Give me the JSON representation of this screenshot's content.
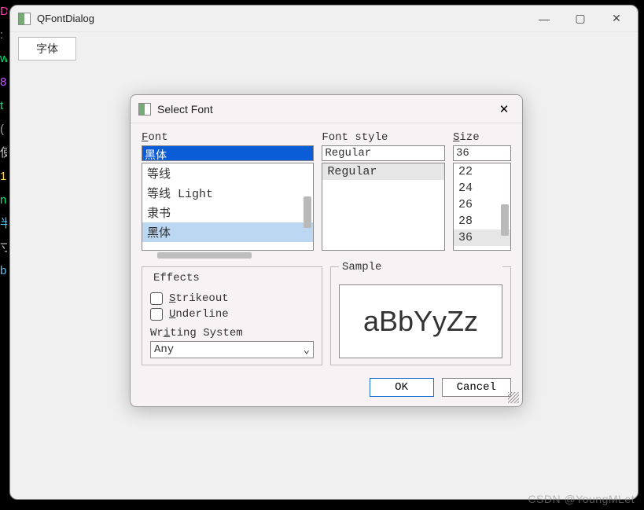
{
  "gutter": [
    "D",
    ":",
    "",
    "w",
    "",
    "8",
    "t",
    "",
    "",
    "(",
    "使",
    "1",
    "n",
    "",
    "半",
    "",
    "寸",
    "",
    "b",
    ""
  ],
  "gutter_colors": [
    "#ff3db3",
    "#9aa0a6",
    "",
    "#00e676",
    "",
    "#c253ff",
    "#00e676",
    "",
    "",
    "#9aa0a6",
    "#c9c9c9",
    "#ffd54a",
    "#00e676",
    "",
    "#4fc3f7",
    "",
    "#c9c9c9",
    "",
    "#4fc3f7",
    ""
  ],
  "main": {
    "title": "QFontDialog",
    "toolbar_button": "字体"
  },
  "dialog": {
    "title": "Select Font",
    "font_label": "Font",
    "font_value": "黑体",
    "font_list": [
      "等线",
      "等线 Light",
      "隶书",
      "黑体"
    ],
    "font_selected_index": 3,
    "style_label": "Font style",
    "style_value": "Regular",
    "style_list": [
      "Regular"
    ],
    "style_selected_index": 0,
    "size_label": "Size",
    "size_value": "36",
    "size_list": [
      "22",
      "24",
      "26",
      "28",
      "36"
    ],
    "size_selected_index": 4,
    "effects_label": "Effects",
    "strikeout_label": "Strikeout",
    "underline_label": "Underline",
    "ws_label": "Writing System",
    "ws_value": "Any",
    "sample_label": "Sample",
    "sample_text": "aBbYyZz",
    "ok_label": "OK",
    "cancel_label": "Cancel"
  },
  "watermark": "CSDN @YoungMLet"
}
